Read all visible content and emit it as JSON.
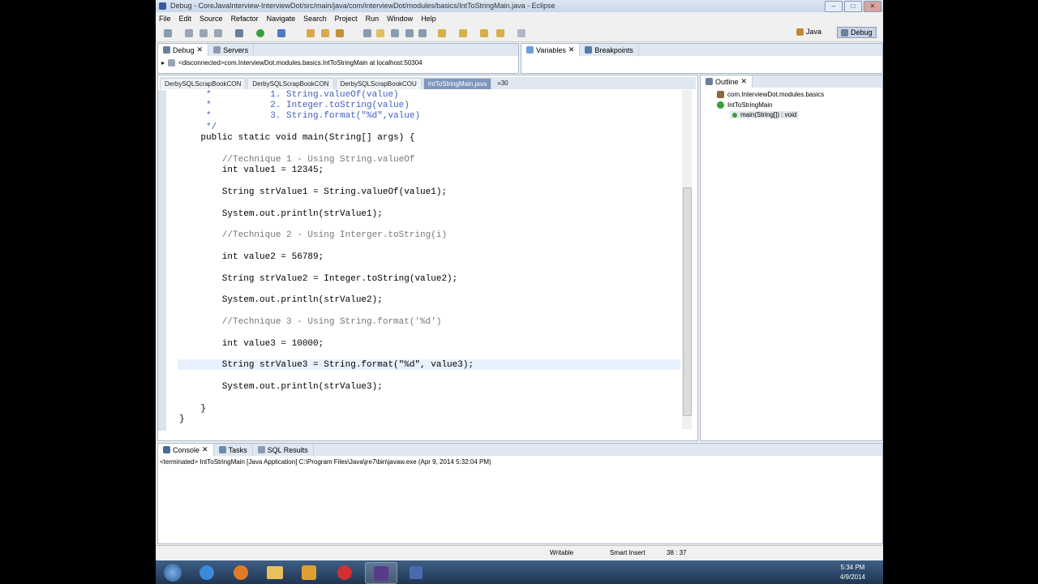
{
  "window": {
    "title": "Debug - CoreJavaInterview-InterviewDot/src/main/java/com/interviewDot/modules/basics/IntToStringMain.java - Eclipse"
  },
  "menu": [
    "File",
    "Edit",
    "Source",
    "Refactor",
    "Navigate",
    "Search",
    "Project",
    "Run",
    "Window",
    "Help"
  ],
  "perspectives": {
    "java": "Java",
    "debug": "Debug"
  },
  "debug_view": {
    "tabs": [
      "Debug",
      "Servers"
    ],
    "item": "<disconnected>com.InterviewDot.modules.basics.IntToStringMain at localhost:50304"
  },
  "variables_view": {
    "tabs": [
      "Variables",
      "Breakpoints"
    ]
  },
  "editor": {
    "tabs": [
      "DerbySQLScrapBookCON",
      "DerbySQLScrapBookCON",
      "DerbySQLScrapBookCOU",
      "IntToStringMain.java",
      "»30"
    ],
    "lines": [
      "     *           1. String.valueOf(value)",
      "     *           2. Integer.toString(value)",
      "     *           3. String.format(\"%d\",value)",
      "     */",
      "    public static void main(String[] args) {",
      "",
      "        //Technique 1 - Using String.valueOf",
      "        int value1 = 12345;",
      "",
      "        String strValue1 = String.valueOf(value1);",
      "",
      "        System.out.println(strValue1);",
      "",
      "        //Technique 2 - Using Interger.toString(i)",
      "",
      "        int value2 = 56789;",
      "",
      "        String strValue2 = Integer.toString(value2);",
      "",
      "        System.out.println(strValue2);",
      "",
      "        //Technique 3 - Using String.format('%d')",
      "",
      "        int value3 = 10000;",
      "",
      "        String strValue3 = String.format(\"%d\", value3);",
      "",
      "        System.out.println(strValue3);",
      "",
      "    }",
      "}"
    ]
  },
  "outline": {
    "tab": "Outline",
    "package": "com.InterviewDot.modules.basics",
    "class": "IntToStringMain",
    "method": "main(String[]) : void"
  },
  "console": {
    "tabs": [
      "Console",
      "Tasks",
      "SQL Results"
    ],
    "terminated": "<terminated> IntToStringMain [Java Application] C:\\Program Files\\Java\\jre7\\bin\\javaw.exe (Apr 9, 2014 5:32:04 PM)"
  },
  "status": {
    "mode": "Writable",
    "insert": "Smart Insert",
    "position": "38 : 37"
  },
  "clock": {
    "time": "5:34 PM",
    "date": "4/9/2014"
  }
}
